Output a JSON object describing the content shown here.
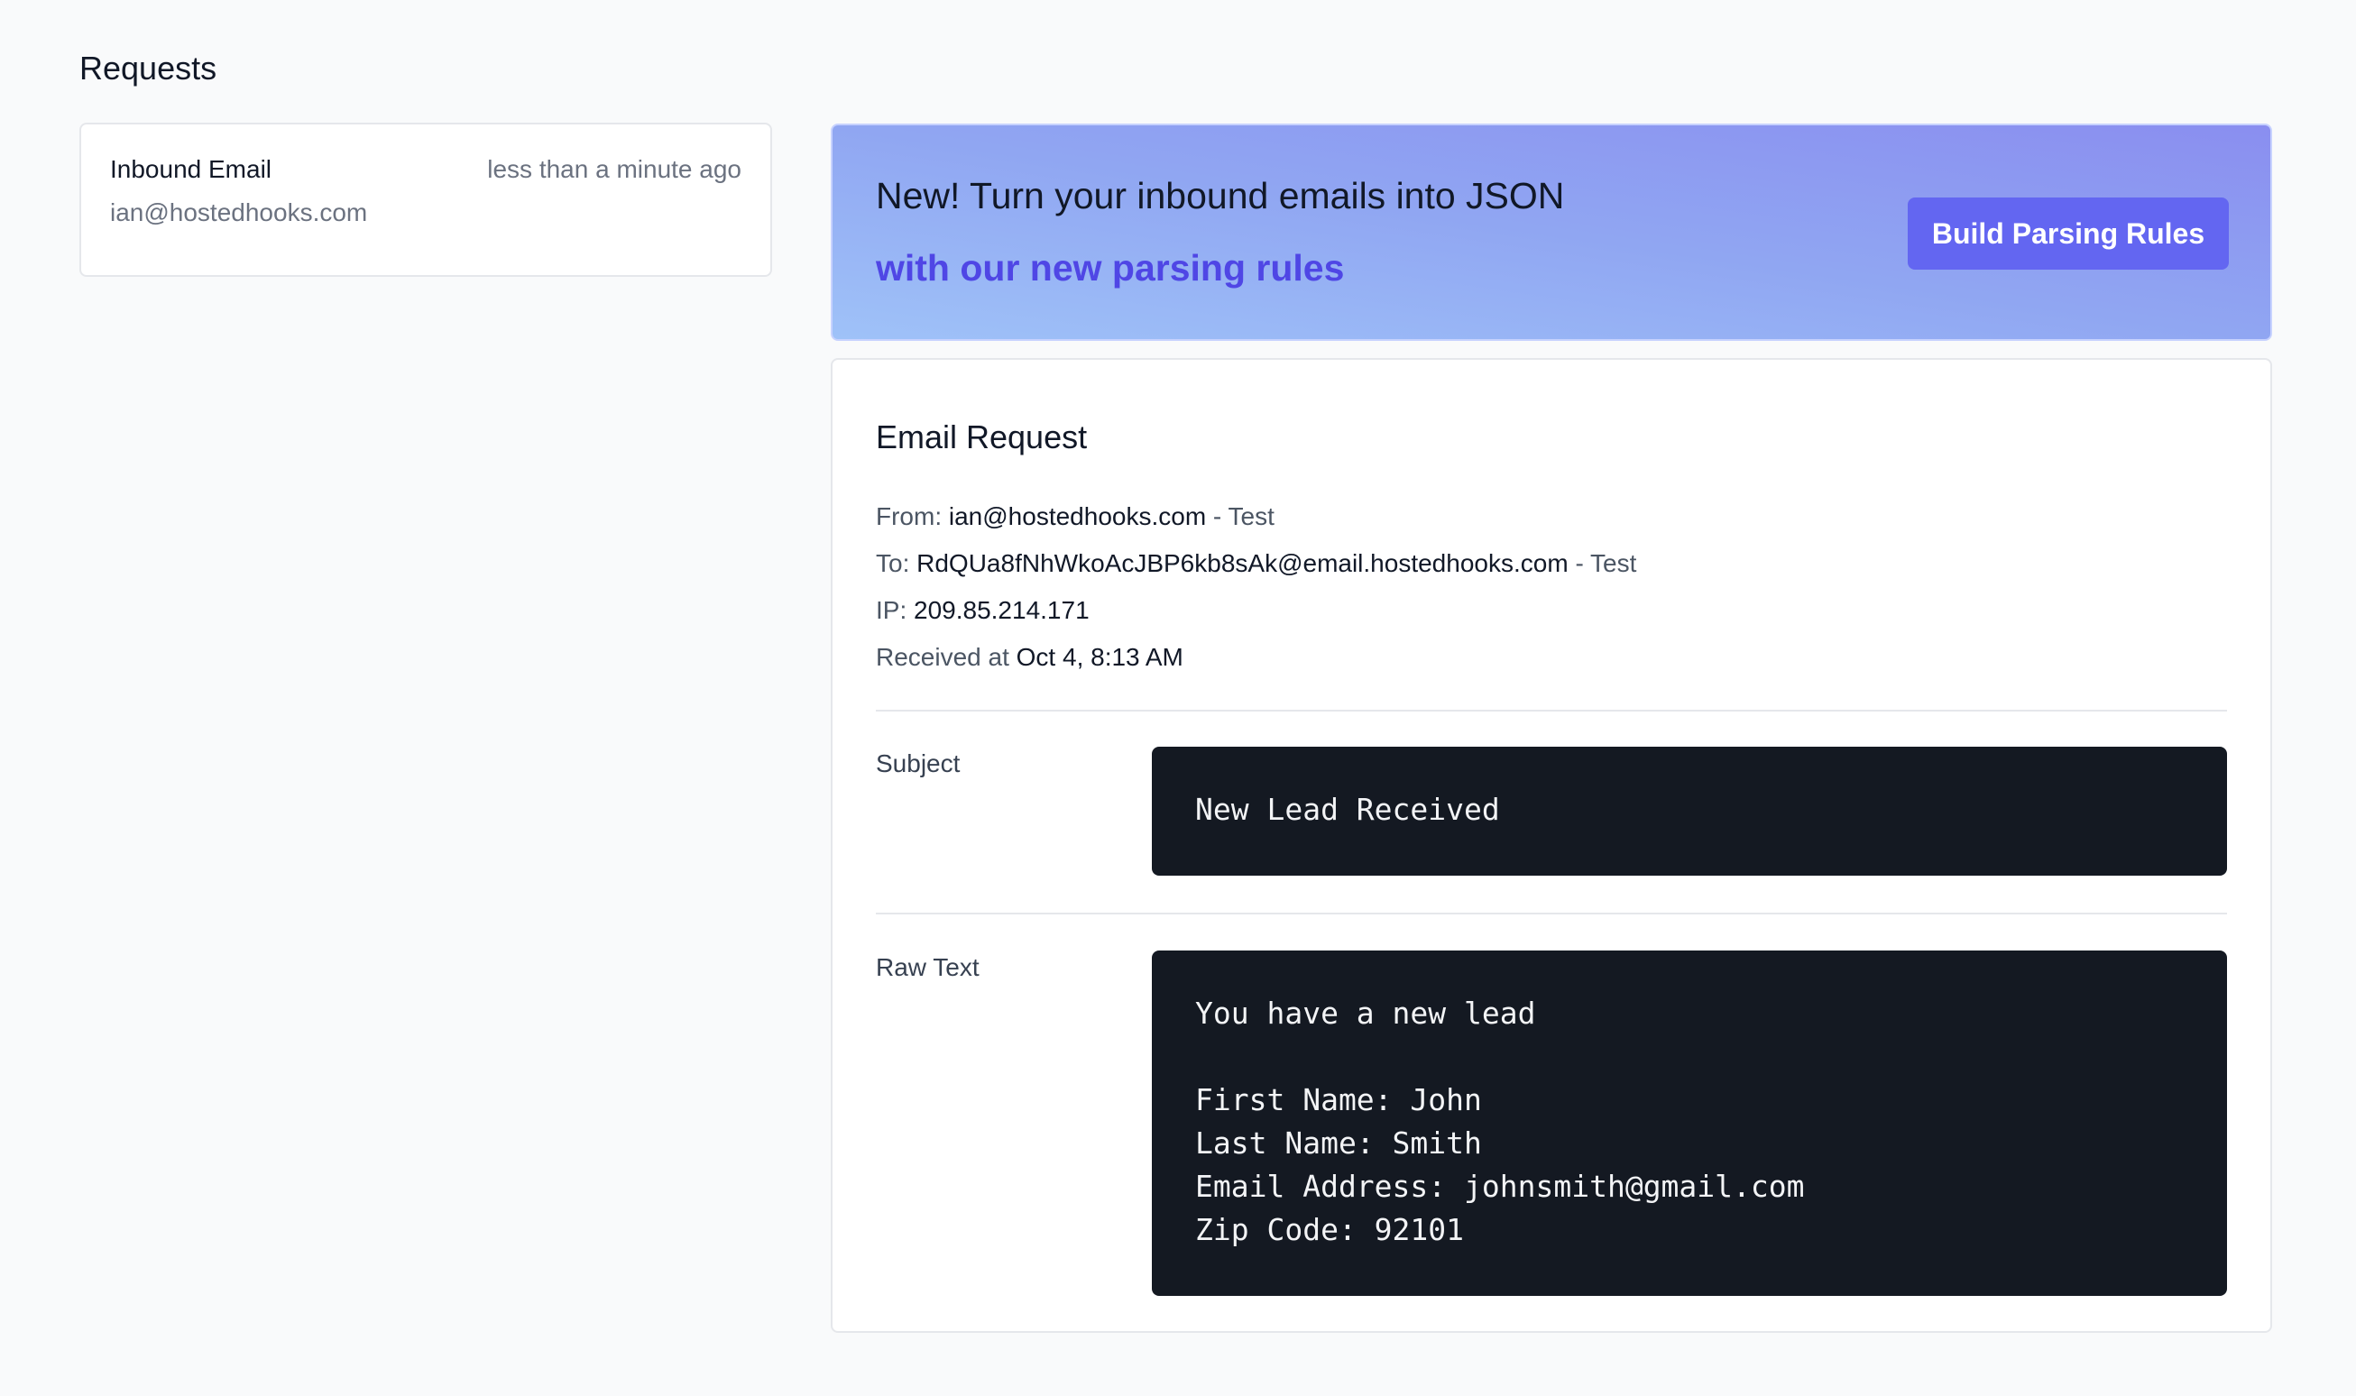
{
  "page": {
    "title": "Requests"
  },
  "requests_list": {
    "items": [
      {
        "kind": "Inbound Email",
        "time": "less than a minute ago",
        "address": "ian@hostedhooks.com"
      }
    ]
  },
  "banner": {
    "headline": "New! Turn your inbound emails into JSON",
    "subline": "with our new parsing rules",
    "cta_label": "Build Parsing Rules"
  },
  "detail": {
    "title": "Email Request",
    "from_label": "From:",
    "from_value": "ian@hostedhooks.com",
    "from_suffix": "- Test",
    "to_label": "To:",
    "to_value": "RdQUa8fNhWkoAcJBP6kb8sAk@email.hostedhooks.com",
    "to_suffix": "- Test",
    "ip_label": "IP:",
    "ip_value": "209.85.214.171",
    "received_label": "Received at",
    "received_value": "Oct 4, 8:13 AM",
    "subject_label": "Subject",
    "subject_value": "New Lead Received",
    "raw_label": "Raw Text",
    "raw_value": "You have a new lead\n\nFirst Name: John\nLast Name: Smith\nEmail Address: johnsmith@gmail.com\nZip Code: 92101"
  },
  "colors": {
    "accent": "#6366f1",
    "accent_text": "#4f46e5",
    "code_bg": "#141922",
    "page_bg": "#f9fafb"
  }
}
